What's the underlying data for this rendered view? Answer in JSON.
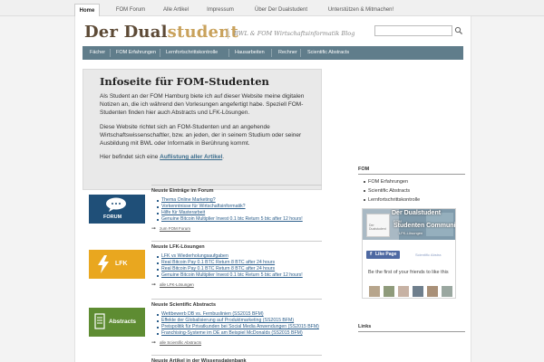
{
  "topnav": {
    "tabs": [
      {
        "label": "Home",
        "active": true
      },
      {
        "label": "FOM Forum"
      },
      {
        "label": "Alle Artikel"
      },
      {
        "label": "Impressum"
      },
      {
        "label": "Über Der Dualstudent"
      },
      {
        "label": "Unterstützen & Mitmachen!"
      }
    ]
  },
  "header": {
    "logo_part1": "Der Dual",
    "logo_part2": "student",
    "tagline": "BWL & FOM Wirtschaftsinformatik Blog"
  },
  "mainnav": {
    "items": [
      "Fächer",
      "FOM Erfahrungen",
      "Lernfortschrittskontrolle",
      "Hausarbeiten",
      "Rechner",
      "Scientific Abstracts"
    ]
  },
  "info": {
    "title": "Infoseite für FOM-Studenten",
    "p1": "Als Student an der FOM Hamburg biete ich auf dieser Website meine digitalen Notizen an, die ich während den Vorlesungen angefertigt habe. Speziell FOM-Studenten finden hier auch Abstracts und LFK-Lösungen.",
    "p2": "Diese Website richtet sich an FOM-Studenten und an angehende Wirtschaftswissenschaftler, bzw. an jeden, der in seinem Studium oder seiner Ausbildung mit BWL oder Informatik in Berührung kommt.",
    "p3_text": "Hier befindet sich eine",
    "p3_link": "Auflistung aller Artikel",
    "p3_end": "."
  },
  "sections": {
    "forum": {
      "badge": "FORUM",
      "head": "Neuste Einträge im Forum",
      "items": [
        "Thema Online Marketing?",
        "Vorkenntnisse für Wirtschaftsinformatik?",
        "Hilfe für Masterarbeit",
        "Genuine Bitcoin Multiplier Invest 0.1 btc Return 5 btc after 12 hours!"
      ],
      "more": "zum FOM Forum"
    },
    "lfk": {
      "badge": "LFK",
      "head": "Neuste LFK-Lösungen",
      "items": [
        "LFK vs Wiederholungsaufgaben",
        "Real Bitcoin Pay 0.1 BTC Return 8 BTC after 24 hours",
        "Real Bitcoin Pay 0.1 BTC Return 8 BTC after 24 hours",
        "Genuine Bitcoin Multiplier Invest 0.1 btc Return 5 btc after 12 hours!"
      ],
      "more": "alle LFK-Lösungen"
    },
    "abstracts": {
      "badge": "Abstracts",
      "head": "Neuste Scientific Abstracts",
      "items": [
        "Wettbewerb DB vs. Fernbuslinien (SS2015 BFM)",
        "Effekte der Globalisierung auf Produktmarketing (SS2015 BFM)",
        "Preispolitik für Privatkunden bei Social Media Anwendungen (SS2015 BFM)",
        "Franchising-Systeme im DE am Beispiel McDonalds (SS2015 BFM)"
      ],
      "more": "alle Scientific Abstracts"
    },
    "wissensdatenbank": {
      "head": "Neuste Artikel in der Wissensdatenbank"
    }
  },
  "sidebar": {
    "fom_head": "FOM",
    "fom_items": [
      "FOM Erfahrungen",
      "Scientific Abstracts",
      "Lernfortschrittskontrolle"
    ],
    "links_head": "Links"
  },
  "facebook": {
    "title": "Der Dualstudent",
    "sub1": "FOM",
    "sub2": "Studenten Communi",
    "sub3": "LFK-Lösungen",
    "thumb": "Der Dualstudent",
    "like": "Like Page",
    "insight": "Scientific Abstra",
    "cta": "Be the first of your friends to like this"
  },
  "colors": {
    "nav_bg": "#607d8b",
    "forum_badge": "#1f4f78",
    "lfk_badge": "#e9a71f",
    "abstracts_badge": "#5e8c32",
    "link": "#2a5d8a",
    "facebook": "#4e69a2"
  }
}
